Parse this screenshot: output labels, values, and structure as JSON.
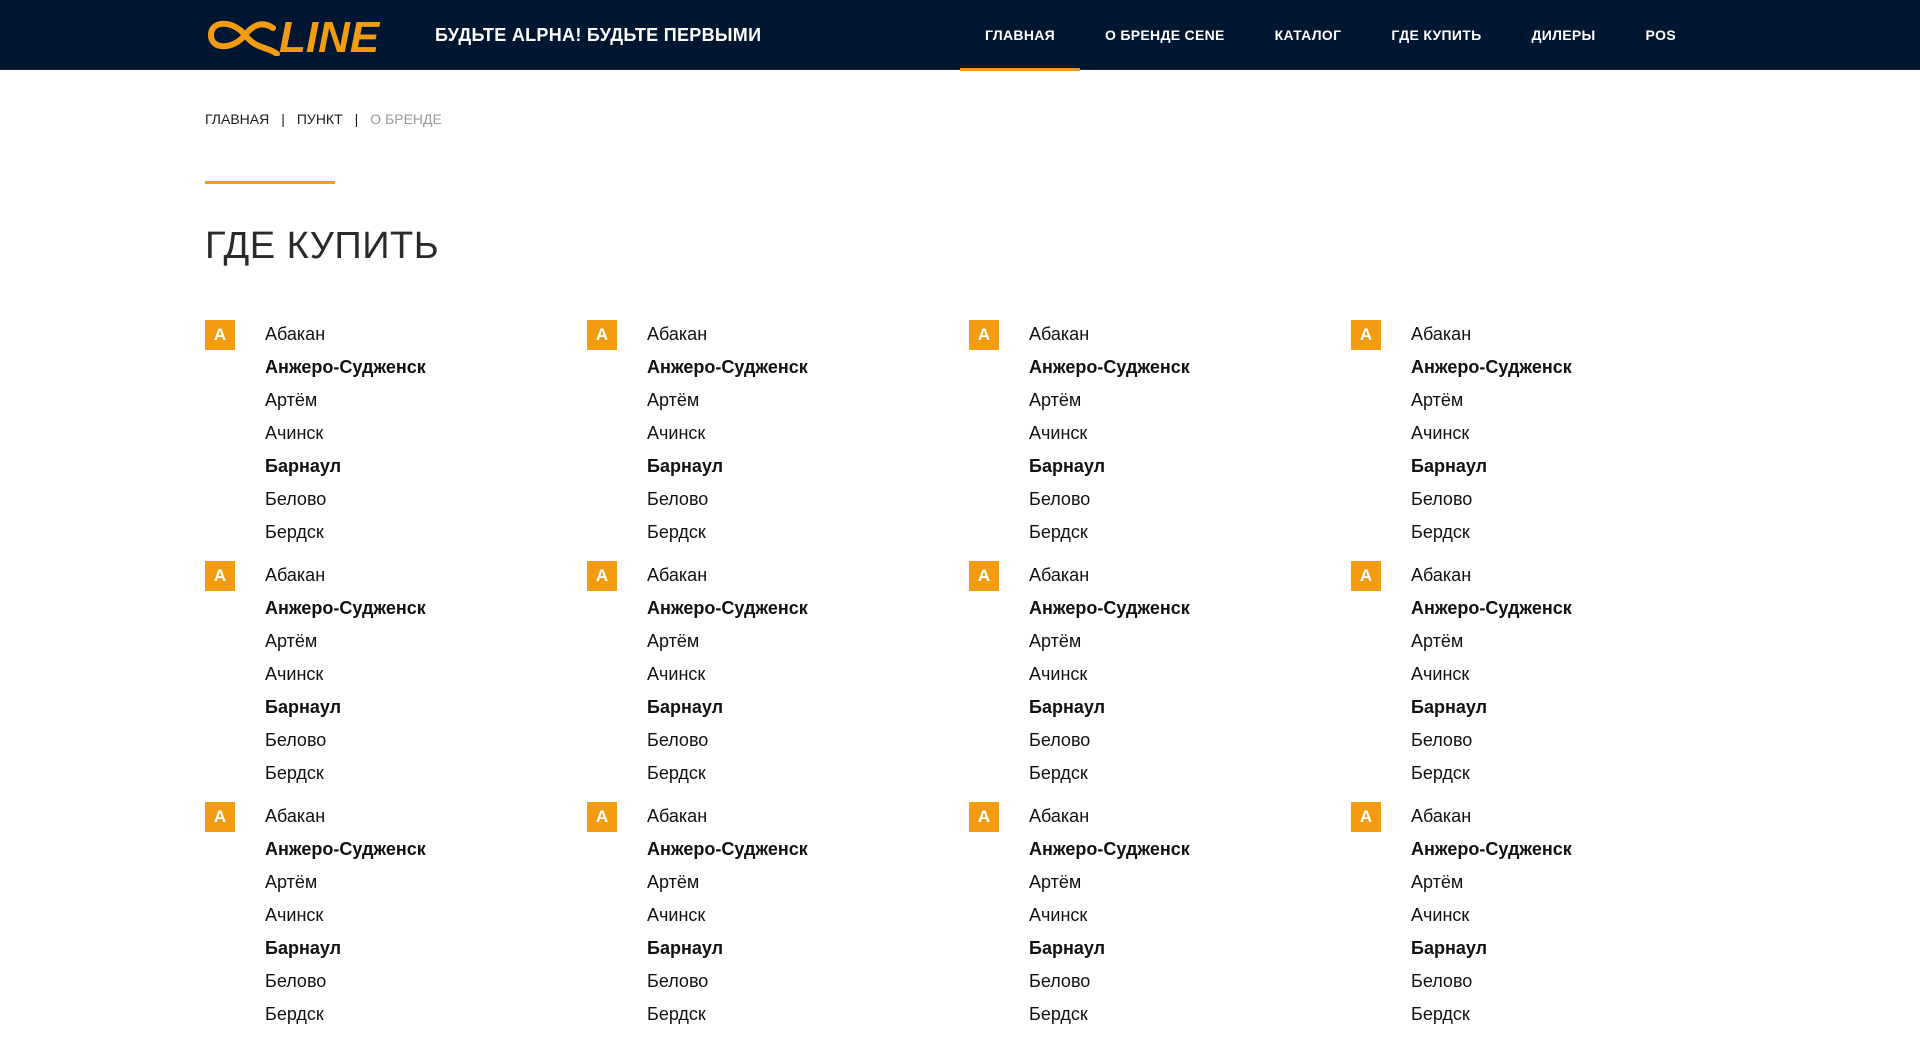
{
  "header": {
    "logo_text": "αLINE",
    "tagline": "БУДЬТЕ ALPHA! БУДЬТЕ ПЕРВЫМИ",
    "nav": [
      {
        "label": "ГЛАВНАЯ",
        "active": true
      },
      {
        "label": "О БРЕНДЕ CENE",
        "active": false
      },
      {
        "label": "КАТАЛОГ",
        "active": false
      },
      {
        "label": "ГДЕ КУПИТЬ",
        "active": false
      },
      {
        "label": "ДИЛЕРЫ",
        "active": false
      },
      {
        "label": "POS",
        "active": false
      }
    ]
  },
  "breadcrumb": {
    "items": [
      "ГЛАВНАЯ",
      "ПУНКТ",
      "О БРЕНДЕ"
    ],
    "separator": "|"
  },
  "page_title": "ГДЕ КУПИТЬ",
  "colors": {
    "header_bg": "#011631",
    "accent": "#f39c12",
    "text": "#111111",
    "muted": "#9a9a9a"
  },
  "city_groups": [
    {
      "letter": "А",
      "cities": [
        {
          "name": "Абакан",
          "bold": false
        },
        {
          "name": "Анжеро-Судженск",
          "bold": true
        },
        {
          "name": "Артём",
          "bold": false
        },
        {
          "name": "Ачинск",
          "bold": false
        },
        {
          "name": "Барнаул",
          "bold": true
        },
        {
          "name": "Белово",
          "bold": false
        },
        {
          "name": "Бердск",
          "bold": false
        }
      ]
    },
    {
      "letter": "А",
      "cities": [
        {
          "name": "Абакан",
          "bold": false
        },
        {
          "name": "Анжеро-Судженск",
          "bold": true
        },
        {
          "name": "Артём",
          "bold": false
        },
        {
          "name": "Ачинск",
          "bold": false
        },
        {
          "name": "Барнаул",
          "bold": true
        },
        {
          "name": "Белово",
          "bold": false
        },
        {
          "name": "Бердск",
          "bold": false
        }
      ]
    },
    {
      "letter": "А",
      "cities": [
        {
          "name": "Абакан",
          "bold": false
        },
        {
          "name": "Анжеро-Судженск",
          "bold": true
        },
        {
          "name": "Артём",
          "bold": false
        },
        {
          "name": "Ачинск",
          "bold": false
        },
        {
          "name": "Барнаул",
          "bold": true
        },
        {
          "name": "Белово",
          "bold": false
        },
        {
          "name": "Бердск",
          "bold": false
        }
      ]
    },
    {
      "letter": "А",
      "cities": [
        {
          "name": "Абакан",
          "bold": false
        },
        {
          "name": "Анжеро-Судженск",
          "bold": true
        },
        {
          "name": "Артём",
          "bold": false
        },
        {
          "name": "Ачинск",
          "bold": false
        },
        {
          "name": "Барнаул",
          "bold": true
        },
        {
          "name": "Белово",
          "bold": false
        },
        {
          "name": "Бердск",
          "bold": false
        }
      ]
    },
    {
      "letter": "А",
      "cities": [
        {
          "name": "Абакан",
          "bold": false
        },
        {
          "name": "Анжеро-Судженск",
          "bold": true
        },
        {
          "name": "Артём",
          "bold": false
        },
        {
          "name": "Ачинск",
          "bold": false
        },
        {
          "name": "Барнаул",
          "bold": true
        },
        {
          "name": "Белово",
          "bold": false
        },
        {
          "name": "Бердск",
          "bold": false
        }
      ]
    },
    {
      "letter": "А",
      "cities": [
        {
          "name": "Абакан",
          "bold": false
        },
        {
          "name": "Анжеро-Судженск",
          "bold": true
        },
        {
          "name": "Артём",
          "bold": false
        },
        {
          "name": "Ачинск",
          "bold": false
        },
        {
          "name": "Барнаул",
          "bold": true
        },
        {
          "name": "Белово",
          "bold": false
        },
        {
          "name": "Бердск",
          "bold": false
        }
      ]
    },
    {
      "letter": "А",
      "cities": [
        {
          "name": "Абакан",
          "bold": false
        },
        {
          "name": "Анжеро-Судженск",
          "bold": true
        },
        {
          "name": "Артём",
          "bold": false
        },
        {
          "name": "Ачинск",
          "bold": false
        },
        {
          "name": "Барнаул",
          "bold": true
        },
        {
          "name": "Белово",
          "bold": false
        },
        {
          "name": "Бердск",
          "bold": false
        }
      ]
    },
    {
      "letter": "А",
      "cities": [
        {
          "name": "Абакан",
          "bold": false
        },
        {
          "name": "Анжеро-Судженск",
          "bold": true
        },
        {
          "name": "Артём",
          "bold": false
        },
        {
          "name": "Ачинск",
          "bold": false
        },
        {
          "name": "Барнаул",
          "bold": true
        },
        {
          "name": "Белово",
          "bold": false
        },
        {
          "name": "Бердск",
          "bold": false
        }
      ]
    },
    {
      "letter": "А",
      "cities": [
        {
          "name": "Абакан",
          "bold": false
        },
        {
          "name": "Анжеро-Судженск",
          "bold": true
        },
        {
          "name": "Артём",
          "bold": false
        },
        {
          "name": "Ачинск",
          "bold": false
        },
        {
          "name": "Барнаул",
          "bold": true
        },
        {
          "name": "Белово",
          "bold": false
        },
        {
          "name": "Бердск",
          "bold": false
        }
      ]
    },
    {
      "letter": "А",
      "cities": [
        {
          "name": "Абакан",
          "bold": false
        },
        {
          "name": "Анжеро-Судженск",
          "bold": true
        },
        {
          "name": "Артём",
          "bold": false
        },
        {
          "name": "Ачинск",
          "bold": false
        },
        {
          "name": "Барнаул",
          "bold": true
        },
        {
          "name": "Белово",
          "bold": false
        },
        {
          "name": "Бердск",
          "bold": false
        }
      ]
    },
    {
      "letter": "А",
      "cities": [
        {
          "name": "Абакан",
          "bold": false
        },
        {
          "name": "Анжеро-Судженск",
          "bold": true
        },
        {
          "name": "Артём",
          "bold": false
        },
        {
          "name": "Ачинск",
          "bold": false
        },
        {
          "name": "Барнаул",
          "bold": true
        },
        {
          "name": "Белово",
          "bold": false
        },
        {
          "name": "Бердск",
          "bold": false
        }
      ]
    },
    {
      "letter": "А",
      "cities": [
        {
          "name": "Абакан",
          "bold": false
        },
        {
          "name": "Анжеро-Судженск",
          "bold": true
        },
        {
          "name": "Артём",
          "bold": false
        },
        {
          "name": "Ачинск",
          "bold": false
        },
        {
          "name": "Барнаул",
          "bold": true
        },
        {
          "name": "Белово",
          "bold": false
        },
        {
          "name": "Бердск",
          "bold": false
        }
      ]
    }
  ]
}
